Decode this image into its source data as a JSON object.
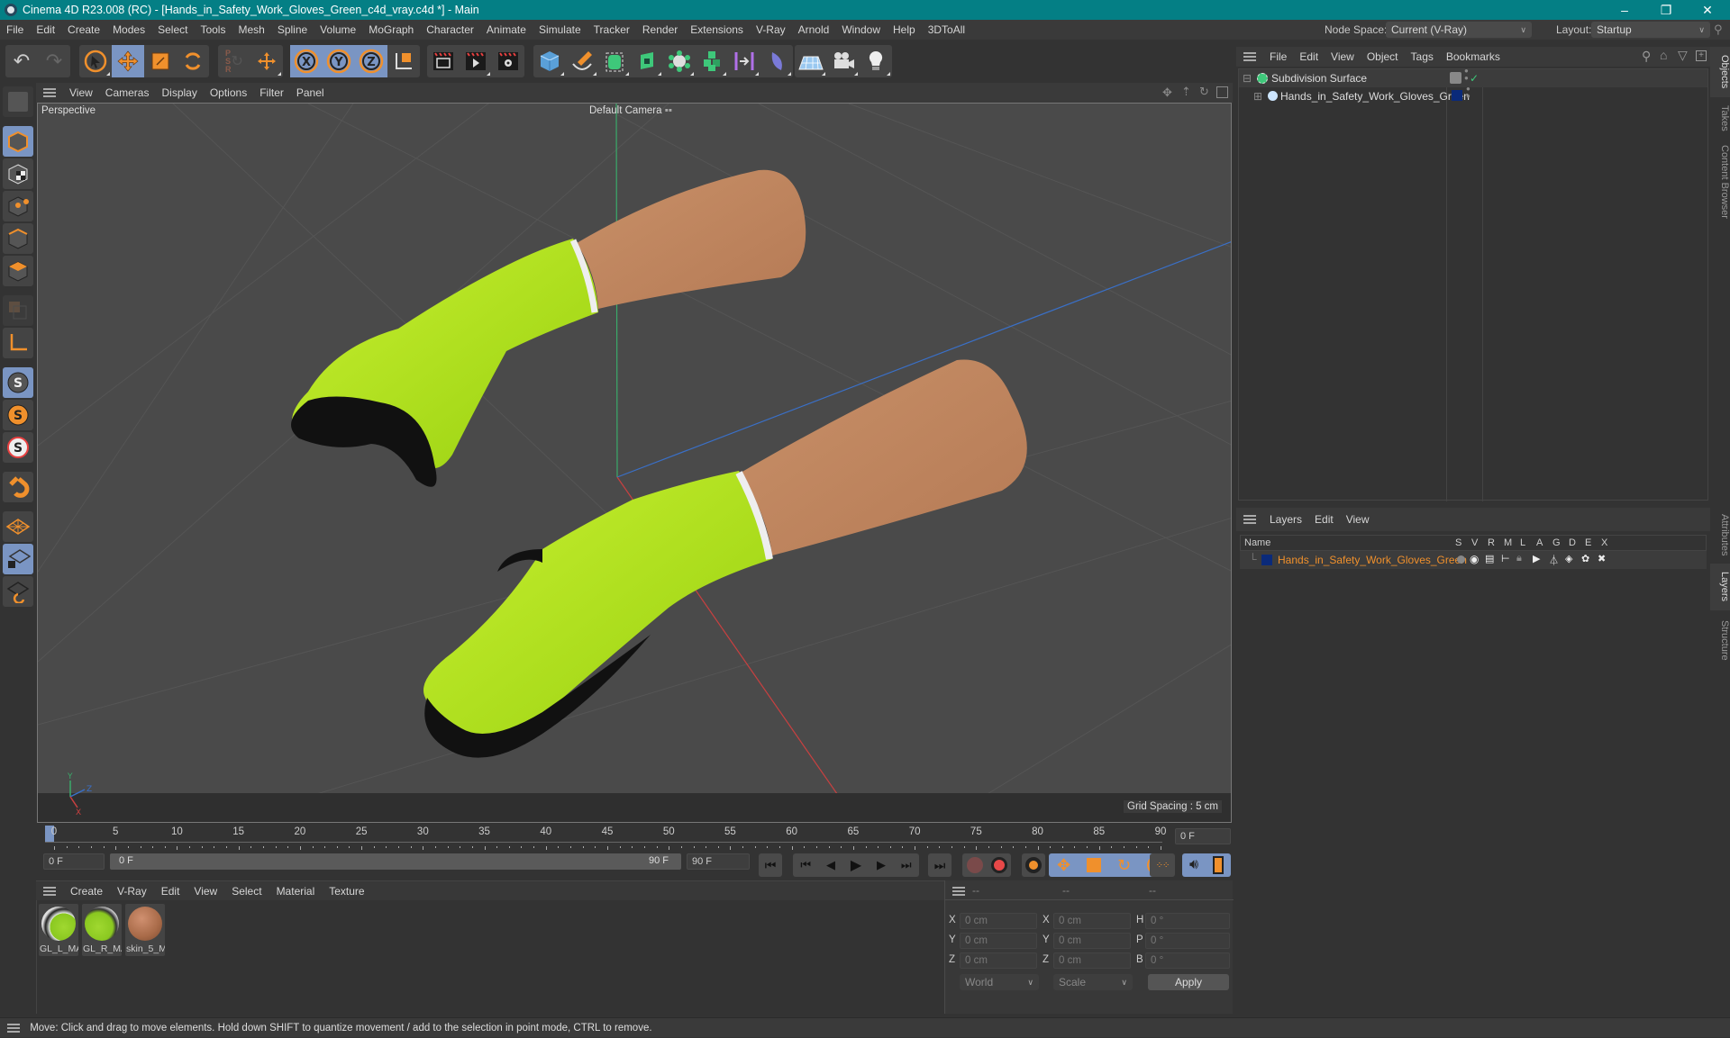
{
  "window": {
    "title": "Cinema 4D R23.008 (RC) - [Hands_in_Safety_Work_Gloves_Green_c4d_vray.c4d *] - Main",
    "controls": [
      "minimize",
      "restore",
      "close"
    ]
  },
  "menubar": {
    "items": [
      "File",
      "Edit",
      "Create",
      "Modes",
      "Select",
      "Tools",
      "Mesh",
      "Spline",
      "Volume",
      "MoGraph",
      "Character",
      "Animate",
      "Simulate",
      "Tracker",
      "Render",
      "Extensions",
      "V-Ray",
      "Arnold",
      "Window",
      "Help",
      "3DToAll"
    ],
    "node_space_label": "Node Space:",
    "node_space_value": "Current (V-Ray)",
    "layout_label": "Layout:",
    "layout_value": "Startup"
  },
  "toolbar": {
    "groups": [
      [
        "undo-icon",
        "redo-icon"
      ],
      [
        "select-icon",
        "move-icon",
        "scale-icon",
        "rotate-icon"
      ],
      [
        "psr-icon",
        "add-icon"
      ],
      [
        "x-axis-icon",
        "y-axis-icon",
        "z-axis-icon",
        "coordinate-system-icon"
      ],
      [
        "render-view-icon",
        "render-picture-viewer-icon",
        "render-settings-icon"
      ],
      [
        "cube-icon",
        "pen-icon",
        "subdivision-icon",
        "extrude-icon",
        "cloner-icon",
        "mograph-icon",
        "symmetry-icon",
        "deformer-icon"
      ],
      [
        "floor-icon",
        "camera-icon",
        "light-icon"
      ]
    ],
    "selected": [
      "move-icon",
      "x-axis-icon",
      "y-axis-icon",
      "z-axis-icon"
    ]
  },
  "left_tools": [
    "make-editable-icon",
    "model-mode-icon",
    "texture-mode-icon",
    "point-mode-icon",
    "edge-mode-icon",
    "polygon-mode-icon",
    "uv-mode-icon",
    "axis-mode-icon",
    "snap-icon",
    "snap-settings-icon",
    "snap-toggle-icon",
    "magnet-icon",
    "workplane-icon",
    "locked-workplane-icon",
    "workplane-align-icon"
  ],
  "viewport": {
    "menu": [
      "View",
      "Cameras",
      "Display",
      "Options",
      "Filter",
      "Panel"
    ],
    "label": "Perspective",
    "camera": "Default Camera",
    "grid_spacing": "Grid Spacing : 5 cm",
    "nav_icons": [
      "move-view-icon",
      "zoom-view-icon",
      "rotate-view-icon",
      "maximize-view-icon"
    ],
    "axis": {
      "y": "Y",
      "z": "Z",
      "x": "X"
    }
  },
  "timeline": {
    "ticks": [
      "0",
      "5",
      "10",
      "15",
      "20",
      "25",
      "30",
      "35",
      "40",
      "45",
      "50",
      "55",
      "60",
      "65",
      "70",
      "75",
      "80",
      "85",
      "90"
    ],
    "current_frame": "0 F",
    "start_field": "0 F",
    "range_start": "0 F",
    "range_end": "90 F",
    "end_field": "90 F",
    "right_frame": "0 F"
  },
  "playback": {
    "buttons": [
      "go-to-start-icon",
      "previous-key-icon",
      "previous-frame-icon",
      "play-icon",
      "next-frame-icon",
      "next-key-icon",
      "go-to-end-icon"
    ],
    "record_buttons": [
      "record-keys-icon",
      "autokey-icon",
      "keyframe-selection-icon",
      "move-key-icon",
      "scale-key-icon",
      "rotate-key-icon",
      "param-key-icon",
      "pla-key-icon",
      "sound-icon",
      "timeline-icon"
    ]
  },
  "materials": {
    "menu": [
      "Create",
      "V-Ray",
      "Edit",
      "View",
      "Select",
      "Material",
      "Texture"
    ],
    "items": [
      {
        "name": "GL_L_MA",
        "type": "glove-left"
      },
      {
        "name": "GL_R_MA",
        "type": "glove-right"
      },
      {
        "name": "skin_5_M",
        "type": "skin"
      }
    ]
  },
  "coordinates": {
    "headers": [
      "--",
      "--",
      "--"
    ],
    "rows": [
      {
        "l1": "X",
        "v1": "0 cm",
        "l2": "X",
        "v2": "0 cm",
        "l3": "H",
        "v3": "0 °"
      },
      {
        "l1": "Y",
        "v1": "0 cm",
        "l2": "Y",
        "v2": "0 cm",
        "l3": "P",
        "v3": "0 °"
      },
      {
        "l1": "Z",
        "v1": "0 cm",
        "l2": "Z",
        "v2": "0 cm",
        "l3": "B",
        "v3": "0 °"
      }
    ],
    "space": "World",
    "mode": "Scale",
    "apply": "Apply"
  },
  "objects": {
    "menu": [
      "File",
      "Edit",
      "View",
      "Object",
      "Tags",
      "Bookmarks"
    ],
    "items": [
      {
        "name": "Subdivision Surface",
        "icon": "subdivision-surface-icon"
      },
      {
        "name": "Hands_in_Safety_Work_Gloves_Green",
        "icon": "null-object-icon",
        "layer_color": "#0a2a7a"
      }
    ]
  },
  "layers": {
    "menu": [
      "Layers",
      "Edit",
      "View"
    ],
    "columns": [
      "Name",
      "S",
      "V",
      "R",
      "M",
      "L",
      "A",
      "G",
      "D",
      "E",
      "X"
    ],
    "items": [
      {
        "name": "Hands_in_Safety_Work_Gloves_Green",
        "color": "#0a2a7a",
        "name_color": "#f0902c"
      }
    ]
  },
  "side_tabs": {
    "top": [
      "Objects",
      "Takes",
      "Content Browser"
    ],
    "bottom": [
      "Attributes",
      "Layers",
      "Structure"
    ]
  },
  "status": "Move: Click and drag to move elements. Hold down SHIFT to quantize movement / add to the selection in point mode, CTRL to remove.",
  "colors": {
    "accent": "#f0902c",
    "selected": "#7a95c3",
    "titlebar": "#047f85"
  }
}
